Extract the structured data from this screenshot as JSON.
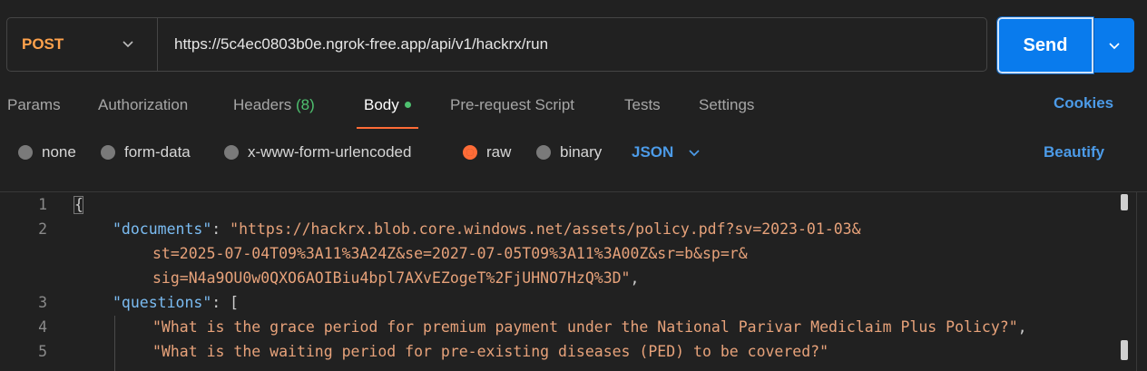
{
  "request": {
    "method": "POST",
    "url": "https://5c4ec0803b0e.ngrok-free.app/api/v1/hackrx/run",
    "send_label": "Send"
  },
  "tabs": [
    {
      "label": "Params"
    },
    {
      "label": "Authorization"
    },
    {
      "label": "Headers",
      "count": "(8)"
    },
    {
      "label": "Body"
    },
    {
      "label": "Pre-request Script"
    },
    {
      "label": "Tests"
    },
    {
      "label": "Settings"
    }
  ],
  "cookies_label": "Cookies",
  "body_types": [
    {
      "label": "none"
    },
    {
      "label": "form-data"
    },
    {
      "label": "x-www-form-urlencoded"
    },
    {
      "label": "raw"
    },
    {
      "label": "binary"
    }
  ],
  "selected_body_type": "raw",
  "language": "JSON",
  "beautify_label": "Beautify",
  "editor": {
    "line_numbers": [
      "1",
      "2",
      "3",
      "4",
      "5"
    ],
    "lines": {
      "l1": "{",
      "l2_key": "\"documents\"",
      "l2_sep": ": ",
      "l2_val_a": "\"https://hackrx.blob.core.windows.net/assets/policy.pdf?sv=2023-01-03&",
      "l2_val_b": "st=2025-07-04T09%3A11%3A24Z&se=2027-07-05T09%3A11%3A00Z&sr=b&sp=r&",
      "l2_val_c": "sig=N4a9OU0w0QXO6AOIBiu4bpl7AXvEZogeT%2FjUHNO7HzQ%3D\"",
      "l2_end": ",",
      "l3_key": "\"questions\"",
      "l3_sep": ": [",
      "l4_val": "\"What is the grace period for premium payment under the National Parivar Mediclaim Plus Policy?\"",
      "l4_end": ",",
      "l5_val": "\"What is the waiting period for pre-existing diseases (PED) to be covered?\""
    }
  },
  "colors": {
    "method": "#ffa24c",
    "send": "#097bed",
    "accent_link": "#4c9be8",
    "active_tab_underline": "#ff6c37",
    "count_green": "#4ec06f",
    "json_key": "#7bbcf2",
    "json_string": "#e7a27a"
  }
}
